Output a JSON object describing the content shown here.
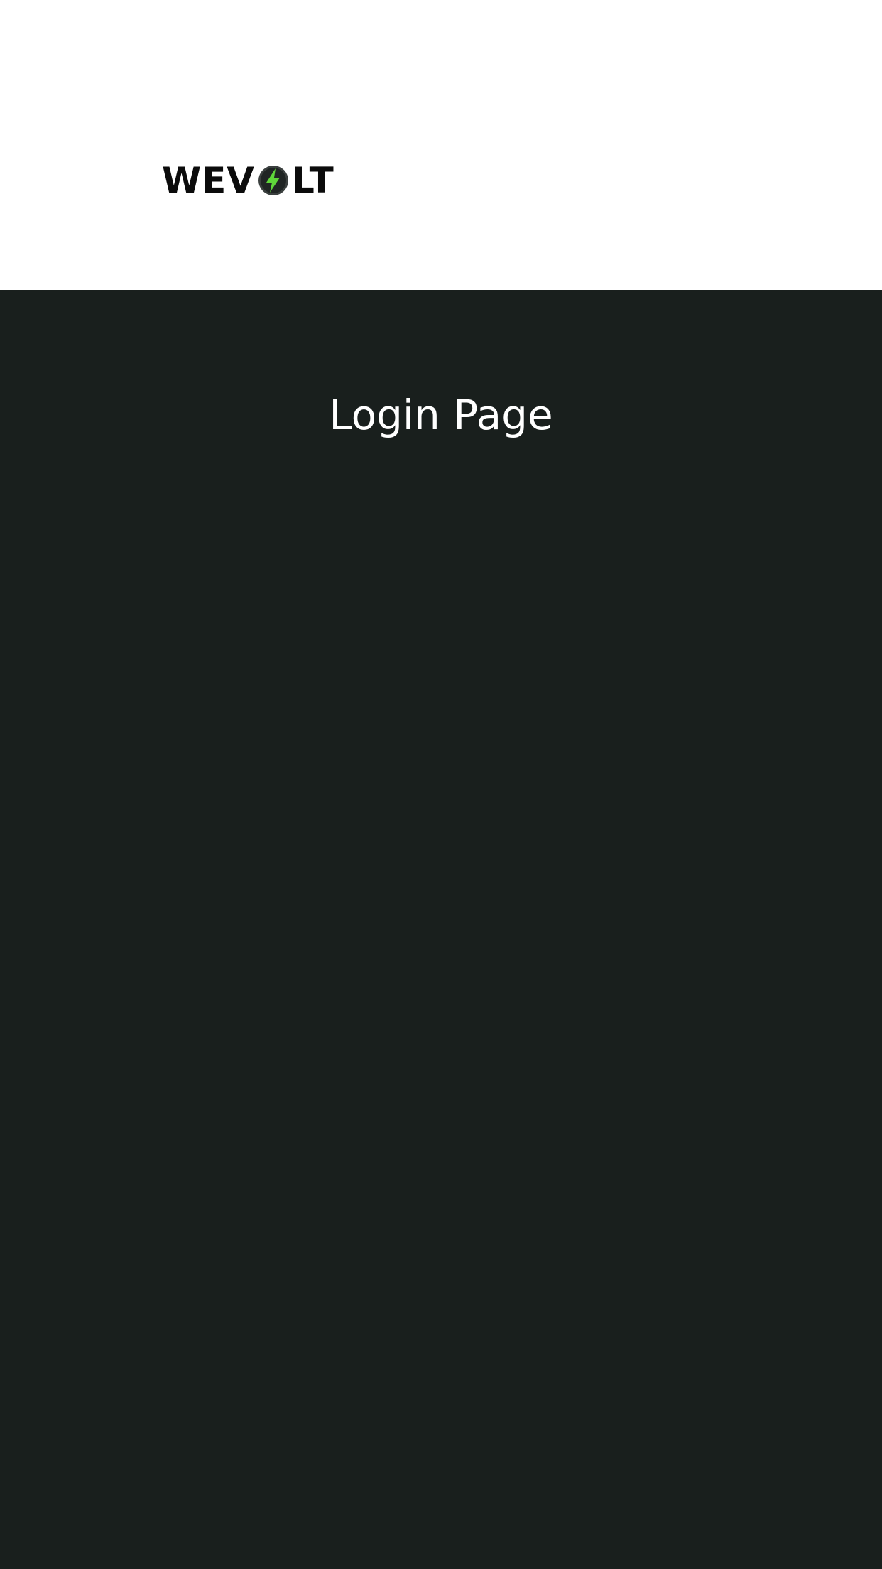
{
  "header": {
    "logo": {
      "text_before": "WEV",
      "text_after": "LT",
      "icon": "lightning-bolt-icon",
      "icon_color": "#5fd63a",
      "icon_ring_color": "#2b2f2e"
    }
  },
  "main": {
    "title": "Login Page"
  },
  "colors": {
    "header_background": "#ffffff",
    "content_background": "#191f1d",
    "title_text": "#ffffff",
    "logo_text": "#0b0b0b"
  }
}
